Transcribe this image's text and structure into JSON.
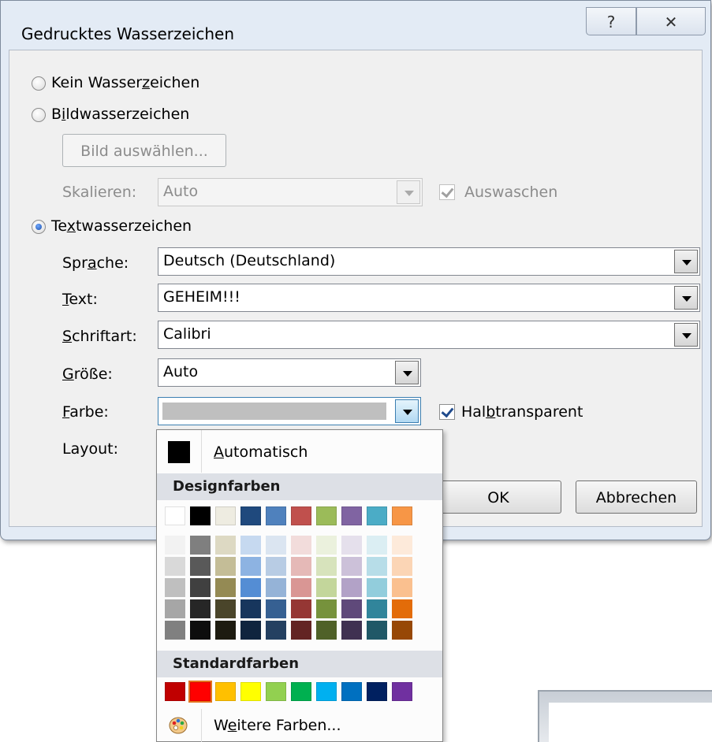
{
  "dialog": {
    "title": "Gedrucktes Wasserzeichen",
    "help_glyph": "?",
    "close_glyph": "✕",
    "no_watermark": {
      "pre": "Kein Wasser",
      "key": "z",
      "post": "eichen"
    },
    "image_watermark": {
      "pre": "B",
      "key": "i",
      "post": "ldwasserzeichen"
    },
    "select_image_label": "Bild auswählen...",
    "scale_label": "Skalieren:",
    "scale_value": "Auto",
    "washout_label": "Auswaschen",
    "text_watermark": {
      "pre": "Te",
      "key": "x",
      "post": "twasserzeichen"
    },
    "language": {
      "pre": "Spr",
      "key": "a",
      "post": "che:",
      "value": "Deutsch (Deutschland)"
    },
    "text": {
      "pre": "",
      "key": "T",
      "post": "ext:",
      "value": "GEHEIM!!!"
    },
    "font": {
      "pre": "",
      "key": "S",
      "post": "chriftart:",
      "value": "Calibri"
    },
    "size": {
      "pre": "",
      "key": "G",
      "post": "röße:",
      "value": "Auto"
    },
    "color": {
      "pre": "",
      "key": "F",
      "post": "arbe:",
      "value_hex": "#bfbfbf"
    },
    "semitransparent": {
      "pre": "Hal",
      "key": "b",
      "post": "transparent"
    },
    "layout_label": "Layout:",
    "ok_label": "OK",
    "cancel_label": "Abbrechen"
  },
  "color_picker": {
    "automatic": {
      "pre": "",
      "key": "A",
      "post": "utomatisch"
    },
    "theme_header": "Designfarben",
    "theme_colors": [
      "#ffffff",
      "#000000",
      "#eeece1",
      "#1f497d",
      "#4f81bd",
      "#c0504d",
      "#9bbb59",
      "#8064a2",
      "#4bacc6",
      "#f79646"
    ],
    "tints": [
      [
        "#f2f2f2",
        "#d9d9d9",
        "#bfbfbf",
        "#a6a6a6",
        "#808080"
      ],
      [
        "#7f7f7f",
        "#595959",
        "#404040",
        "#262626",
        "#0d0d0d"
      ],
      [
        "#ddd9c3",
        "#c4bd97",
        "#948a54",
        "#4a452a",
        "#1d1b10"
      ],
      [
        "#c6d9f0",
        "#8db3e2",
        "#548dd4",
        "#17365d",
        "#0f243e"
      ],
      [
        "#dbe5f1",
        "#b8cce4",
        "#95b3d7",
        "#366092",
        "#244061"
      ],
      [
        "#f2dcdb",
        "#e5b9b7",
        "#d99694",
        "#953734",
        "#632423"
      ],
      [
        "#ebf1dd",
        "#d7e3bc",
        "#c3d69b",
        "#76923c",
        "#4f6128"
      ],
      [
        "#e5e0ec",
        "#ccc1d9",
        "#b2a2c7",
        "#5f497a",
        "#3f3151"
      ],
      [
        "#dbeef3",
        "#b7dde8",
        "#92cddc",
        "#31859b",
        "#205867"
      ],
      [
        "#fdeada",
        "#fbd5b5",
        "#fac08f",
        "#e36c09",
        "#974806"
      ]
    ],
    "standard_header": "Standardfarben",
    "standard_colors": [
      "#c00000",
      "#ff0000",
      "#ffc000",
      "#ffff00",
      "#92d050",
      "#00b050",
      "#00b0f0",
      "#0070c0",
      "#002060",
      "#7030a0"
    ],
    "selected_standard_index": 1,
    "more_colors": {
      "pre": "W",
      "key": "e",
      "post": "itere Farben..."
    }
  }
}
